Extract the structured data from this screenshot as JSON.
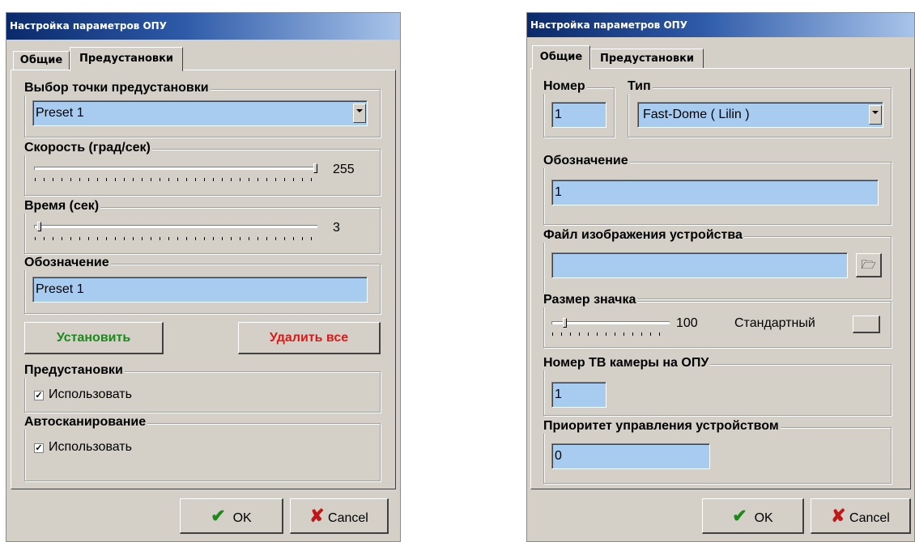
{
  "left": {
    "title": "Настройка параметров ОПУ",
    "tabs": [
      "Общие",
      "Предустановки"
    ],
    "preset_group": "Выбор точки предустановки",
    "preset_value": "Preset 1",
    "speed_group": "Скорость (град/сек)",
    "speed_value": "255",
    "speed_fraction": 1.0,
    "time_group": "Время (сек)",
    "time_value": "3",
    "time_fraction": 0.0,
    "designation_group": "Обозначение",
    "designation_value": "Preset 1",
    "set_button": "Установить",
    "delete_all_button": "Удалить все",
    "presets_group": "Предустановки",
    "presets_use": "Использовать",
    "autoscan_group": "Автосканирование",
    "autoscan_use": "Использовать",
    "ok": "OK",
    "cancel": "Cancel"
  },
  "right": {
    "title": "Настройка параметров ОПУ",
    "tabs": [
      "Общие",
      "Предустановки"
    ],
    "number_group": "Номер",
    "number_value": "1",
    "type_group": "Тип",
    "type_value": "Fast-Dome ( Lilin )",
    "designation_group": "Обозначение",
    "designation_value": "1",
    "file_group": "Файл изображения устройства",
    "file_value": "",
    "icon_size_group": "Размер значка",
    "icon_size_value": "100",
    "icon_size_fraction": 0.0,
    "standard_label": "Стандартный",
    "camera_group": "Номер ТВ камеры на ОПУ",
    "camera_value": "1",
    "priority_group": "Приоритет управления устройством",
    "priority_value": "0",
    "ok": "OK",
    "cancel": "Cancel"
  },
  "colors": {
    "field_bg": "#a8ccf0",
    "dialog_bg": "#d4d0c8",
    "set_text": "#1a8a1a",
    "delete_text": "#e01818"
  }
}
